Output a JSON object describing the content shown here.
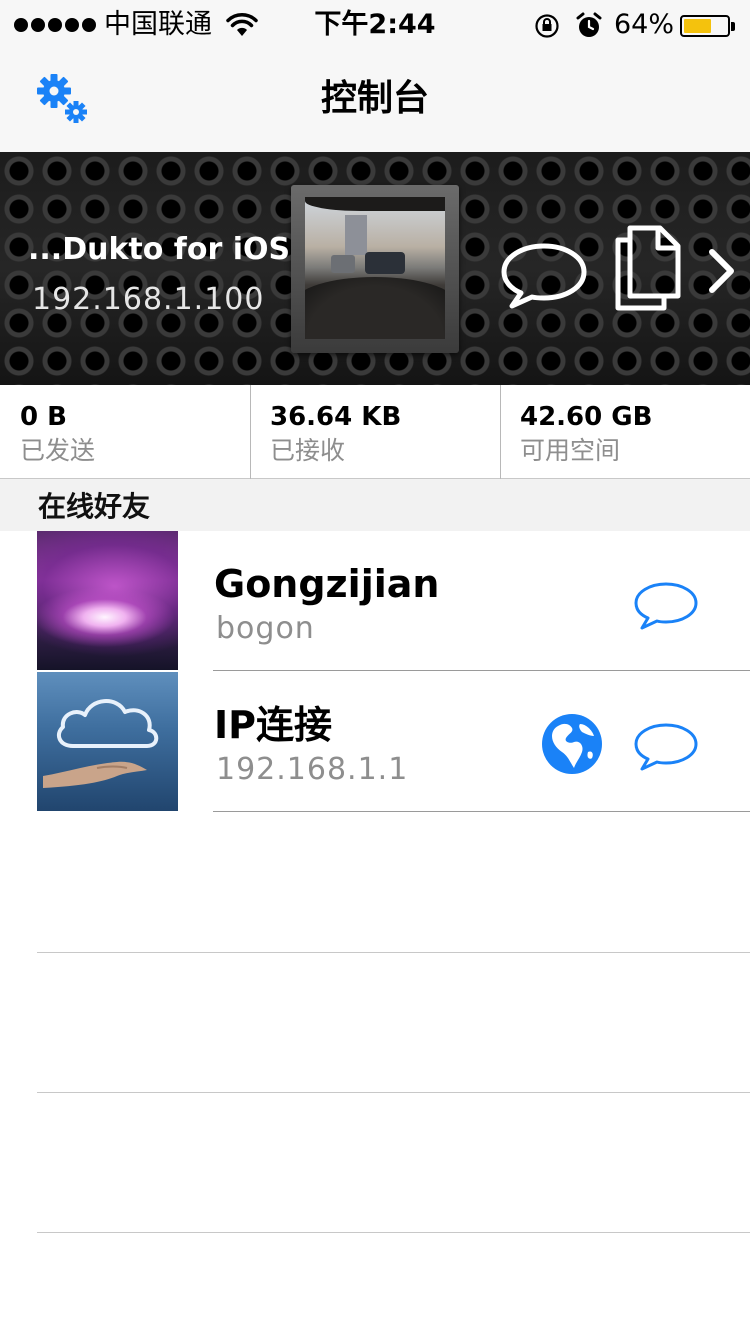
{
  "status_bar": {
    "carrier": "中国联通",
    "time": "下午2:44",
    "battery_percent_text": "64%",
    "battery_level": 0.64,
    "battery_color": "#f4c20d",
    "icons": [
      "signal-dots",
      "wifi-icon",
      "orientation-lock-icon",
      "alarm-icon",
      "battery-icon"
    ]
  },
  "nav": {
    "title": "控制台",
    "left_icon": "gear-icon",
    "accent_color": "#1a82f7"
  },
  "device": {
    "name": "...Dukto for iOS",
    "ip": "192.168.1.100",
    "actions": [
      "chat-bubble-icon",
      "files-icon",
      "chevron-right-icon"
    ]
  },
  "stats": [
    {
      "value": "0 B",
      "label": "已发送"
    },
    {
      "value": "36.64 KB",
      "label": "已接收"
    },
    {
      "value": "42.60 GB",
      "label": "可用空间"
    }
  ],
  "section": {
    "title": "在线好友"
  },
  "friends": [
    {
      "name": "Gongzijian",
      "sub": "bogon",
      "avatar": "galaxy-image",
      "actions": [
        "chat-bubble-icon"
      ]
    },
    {
      "name": "IP连接",
      "sub": "192.168.1.1",
      "avatar": "cloud-hand-image",
      "actions": [
        "globe-icon",
        "chat-bubble-icon"
      ]
    }
  ]
}
